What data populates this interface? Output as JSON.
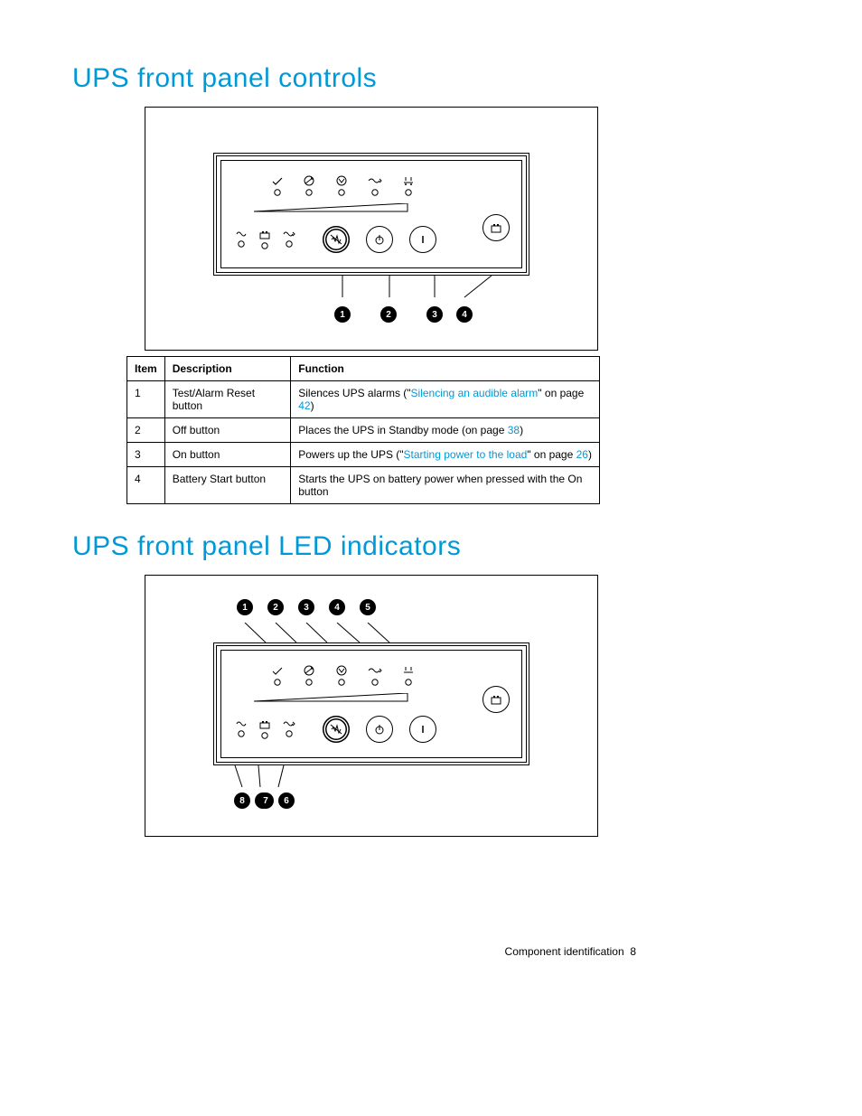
{
  "section1": {
    "heading": "UPS front panel controls",
    "callouts": [
      "1",
      "2",
      "3",
      "4"
    ],
    "table": {
      "headers": [
        "Item",
        "Description",
        "Function"
      ],
      "rows": [
        {
          "item": "1",
          "desc": "Test/Alarm Reset button",
          "func_pre": "Silences UPS alarms (\"",
          "func_link": "Silencing an audible alarm",
          "func_post": "\" on page ",
          "func_page": "42",
          "func_tail": ")"
        },
        {
          "item": "2",
          "desc": "Off button",
          "func_pre": "Places the UPS in Standby mode (on page ",
          "func_link": "",
          "func_post": "",
          "func_page": "38",
          "func_tail": ")"
        },
        {
          "item": "3",
          "desc": "On button",
          "func_pre": "Powers up the UPS (\"",
          "func_link": "Starting power to the load",
          "func_post": "\" on page ",
          "func_page": "26",
          "func_tail": ")"
        },
        {
          "item": "4",
          "desc": "Battery Start button",
          "func_pre": "Starts the UPS on battery power when pressed with the On button",
          "func_link": "",
          "func_post": "",
          "func_page": "",
          "func_tail": ""
        }
      ]
    }
  },
  "section2": {
    "heading": "UPS front panel LED indicators",
    "callouts_top": [
      "1",
      "2",
      "3",
      "4",
      "5"
    ],
    "callouts_bottom": [
      "8",
      "7",
      "6"
    ]
  },
  "footer": {
    "section": "Component identification",
    "page": "8"
  }
}
